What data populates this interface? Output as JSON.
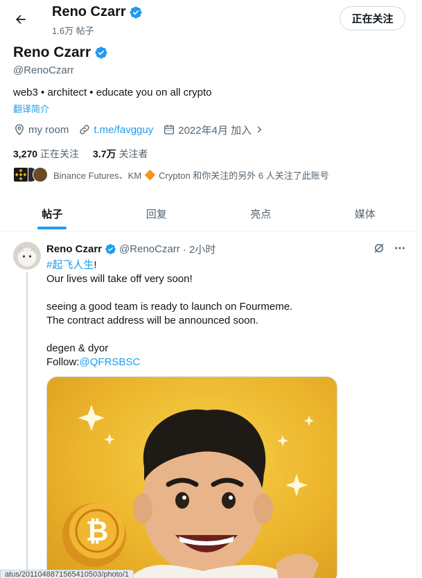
{
  "header": {
    "name": "Reno Czarr",
    "post_count": "1.6万 帖子",
    "follow_button": "正在关注"
  },
  "profile": {
    "name": "Reno Czarr",
    "handle": "@RenoCzarr",
    "bio": "web3 • architect • educate you on all crypto",
    "translate": "翻译简介",
    "location": "my room",
    "link": "t.me/favgguy",
    "joined": "2022年4月 加入",
    "following_count": "3,270",
    "following_label": "正在关注",
    "followers_count": "3.7万",
    "followers_label": "关注者",
    "followed_by_a": "Binance Futures、KM",
    "followed_by_b": "Crypton 和你关注的另外 6 人关注了此账号"
  },
  "tabs": [
    {
      "label": "帖子",
      "active": true
    },
    {
      "label": "回复",
      "active": false
    },
    {
      "label": "亮点",
      "active": false
    },
    {
      "label": "媒体",
      "active": false
    }
  ],
  "tweet": {
    "name": "Reno Czarr",
    "handle": "@RenoCzarr",
    "time": "· 2小时",
    "hashtag": "#起飞人生",
    "hashtag_suffix": "!",
    "line1": "Our lives will take off very soon!",
    "line2": "seeing a good team is ready to launch on Fourmeme.",
    "line3": "The contract address will be announced soon.",
    "line4": "degen & dyor",
    "follow_prefix": "Follow:",
    "mention": "@QFRSBSC"
  },
  "status_url": "atus/2011048871565410503/photo/1",
  "colors": {
    "accent": "#1d9bf0",
    "text": "#0f1419",
    "secondary": "#536471",
    "border": "#cfd9de"
  }
}
